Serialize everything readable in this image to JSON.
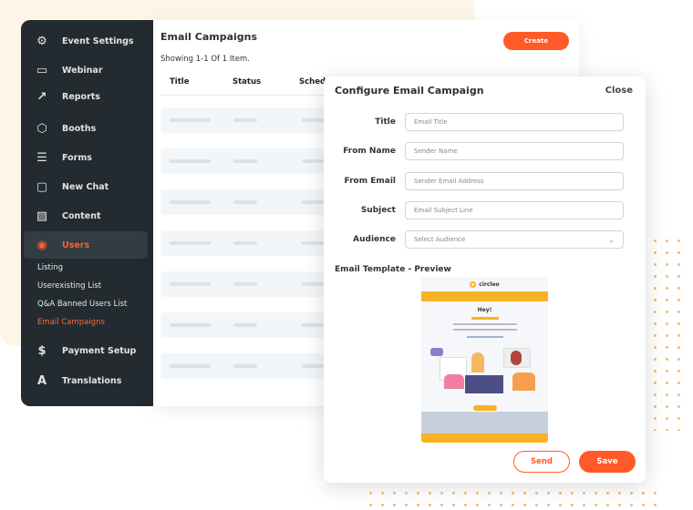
{
  "colors": {
    "accent": "#ff5a28",
    "sidebar": "#232b30",
    "preview_brand": "#fbb124"
  },
  "sidebar": {
    "items": [
      {
        "label": "Event Settings",
        "icon": "gear-icon"
      },
      {
        "label": "Webinar",
        "icon": "monitor-icon"
      },
      {
        "label": "Reports",
        "icon": "chart-icon"
      },
      {
        "label": "Booths",
        "icon": "cube-icon"
      },
      {
        "label": "Forms",
        "icon": "forms-icon"
      },
      {
        "label": "New Chat",
        "icon": "chat-icon"
      },
      {
        "label": "Content",
        "icon": "image-icon"
      },
      {
        "label": "Users",
        "icon": "user-circle-icon",
        "active": true
      },
      {
        "label": "Payment Setup",
        "icon": "dollar-icon"
      },
      {
        "label": "Translations",
        "icon": "translate-icon"
      }
    ],
    "subitems": [
      {
        "label": "Listing"
      },
      {
        "label": "Userexisting List"
      },
      {
        "label": "Q&A Banned Users List"
      },
      {
        "label": "Email Campaigns",
        "active": true
      }
    ]
  },
  "main": {
    "title": "Email Campaigns",
    "showing": "Showing 1-1 Of 1 Item.",
    "create": "Create",
    "columns": [
      "Title",
      "Status",
      "Schedu"
    ]
  },
  "modal": {
    "title": "Configure Email Campaign",
    "close": "Close",
    "fields": [
      {
        "label": "Title",
        "placeholder": "Email Title"
      },
      {
        "label": "From Name",
        "placeholder": "Sender Name"
      },
      {
        "label": "From Email",
        "placeholder": "Sender Email Address"
      },
      {
        "label": "Subject",
        "placeholder": "Email Subject Line"
      },
      {
        "label": "Audience",
        "placeholder": "Select Audience"
      }
    ],
    "template_label": "Email Template - Preview",
    "preview": {
      "logo": "circleo",
      "greeting": "Hey!"
    },
    "send": "Send",
    "save": "Save"
  }
}
